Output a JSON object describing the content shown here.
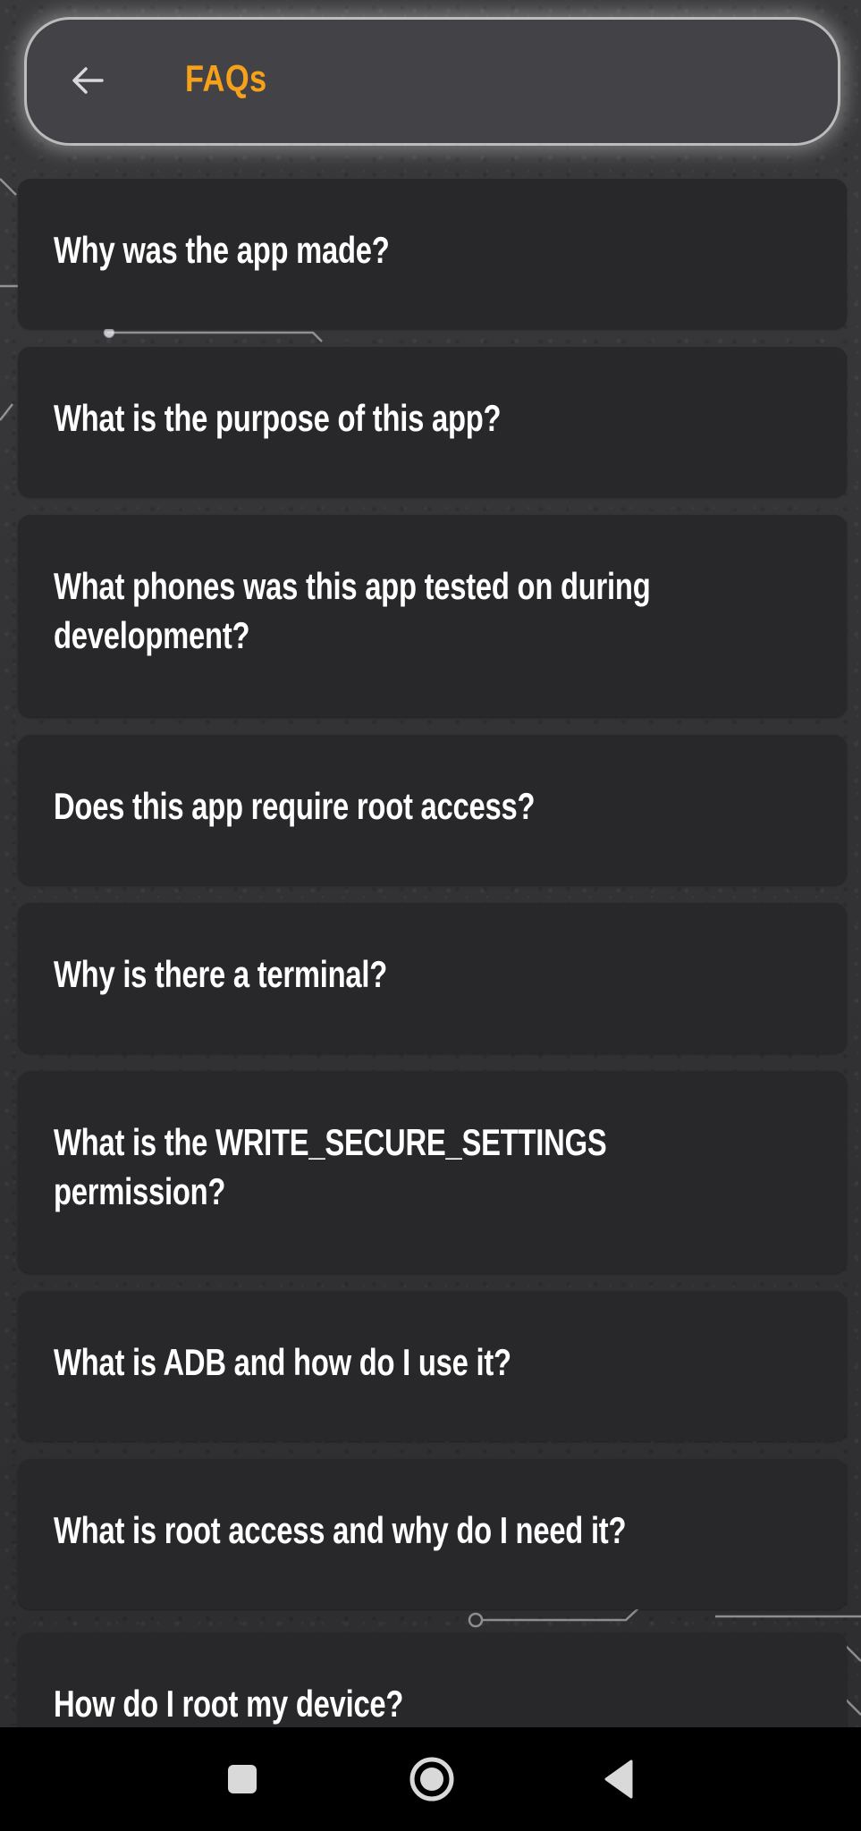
{
  "header": {
    "title": "FAQs",
    "back_icon": "arrow-left-icon",
    "title_color": "#f5a11a"
  },
  "faqs": [
    {
      "question": "Why was the app made?"
    },
    {
      "question": "What is the purpose of this app?"
    },
    {
      "question": "What phones was this app tested on during development?"
    },
    {
      "question": "Does this app require root access?"
    },
    {
      "question": "Why is there a terminal?"
    },
    {
      "question": "What is the WRITE_SECURE_SETTINGS permission?"
    },
    {
      "question": "What is ADB and how do I use it?"
    },
    {
      "question": "What is root access and why do I need it?"
    },
    {
      "question": "How do I root my device?"
    }
  ],
  "navbar": {
    "recents_icon": "square-recents-icon",
    "home_icon": "circle-home-icon",
    "back_icon": "triangle-back-icon"
  }
}
